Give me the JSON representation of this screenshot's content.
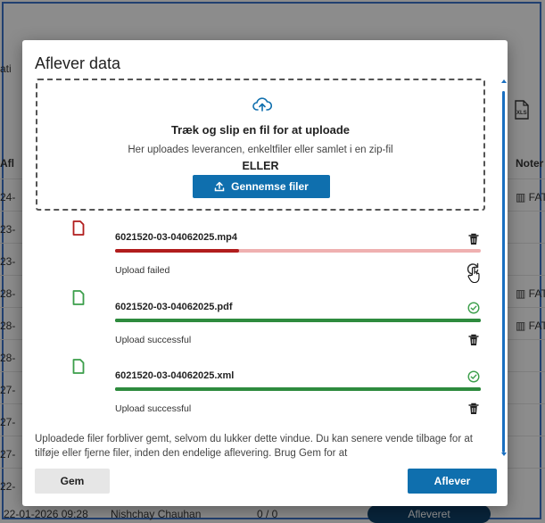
{
  "background": {
    "partial_labels": [
      "ati",
      "Afl",
      "Noter"
    ],
    "row_fragments": [
      "24-",
      "23-",
      "23-",
      "28-",
      "28-",
      "28-",
      "27-",
      "27-",
      "27-",
      "22-"
    ],
    "fat_labels": [
      "FAT",
      "FAT",
      "FAT"
    ],
    "last_row": {
      "date": "22-01-2026 09:28",
      "name": "Nishchay Chauhan",
      "count": "0 / 0",
      "status": "Afleveret"
    },
    "xls_label": "XLS",
    "xls_icon": "xls-file-icon"
  },
  "modal": {
    "title": "Aflever data",
    "dropzone": {
      "icon": "cloud-upload-icon",
      "title": "Træk og slip en fil for at uploade",
      "subtitle": "Her uploades leverancen, enkeltfiler eller samlet i en zip-fil",
      "or_text": "ELLER",
      "browse_label": "Gennemse filer",
      "browse_icon": "upload-icon"
    },
    "files": [
      {
        "name": "6021520-03-04062025.mp4",
        "status": "Upload failed",
        "state": "failed",
        "progress": 0.34,
        "icon": "file-icon",
        "action_icons": [
          "trash-icon",
          "retry-icon"
        ]
      },
      {
        "name": "6021520-03-04062025.pdf",
        "status": "Upload successful",
        "state": "success",
        "progress": 1.0,
        "icon": "file-icon",
        "action_icons": [
          "check-circle-icon",
          "trash-icon"
        ]
      },
      {
        "name": "6021520-03-04062025.xml",
        "status": "Upload successful",
        "state": "success",
        "progress": 1.0,
        "icon": "file-icon",
        "action_icons": [
          "check-circle-icon",
          "trash-icon"
        ]
      }
    ],
    "info_text": "Uploadede filer forbliver gemt, selvom du lukker dette vindue. Du kan senere vende tilbage for at tilføje eller fjerne filer, inden den endelige aflevering. Brug Gem for at",
    "buttons": {
      "save": "Gem",
      "submit": "Aflever"
    }
  },
  "colors": {
    "primary": "#0f6fae",
    "error": "#b11d1d",
    "error_track": "#efb0b0",
    "success": "#2e8b3e",
    "success_icon": "#3b9e4a",
    "scrollbar": "#1a6fc0"
  }
}
